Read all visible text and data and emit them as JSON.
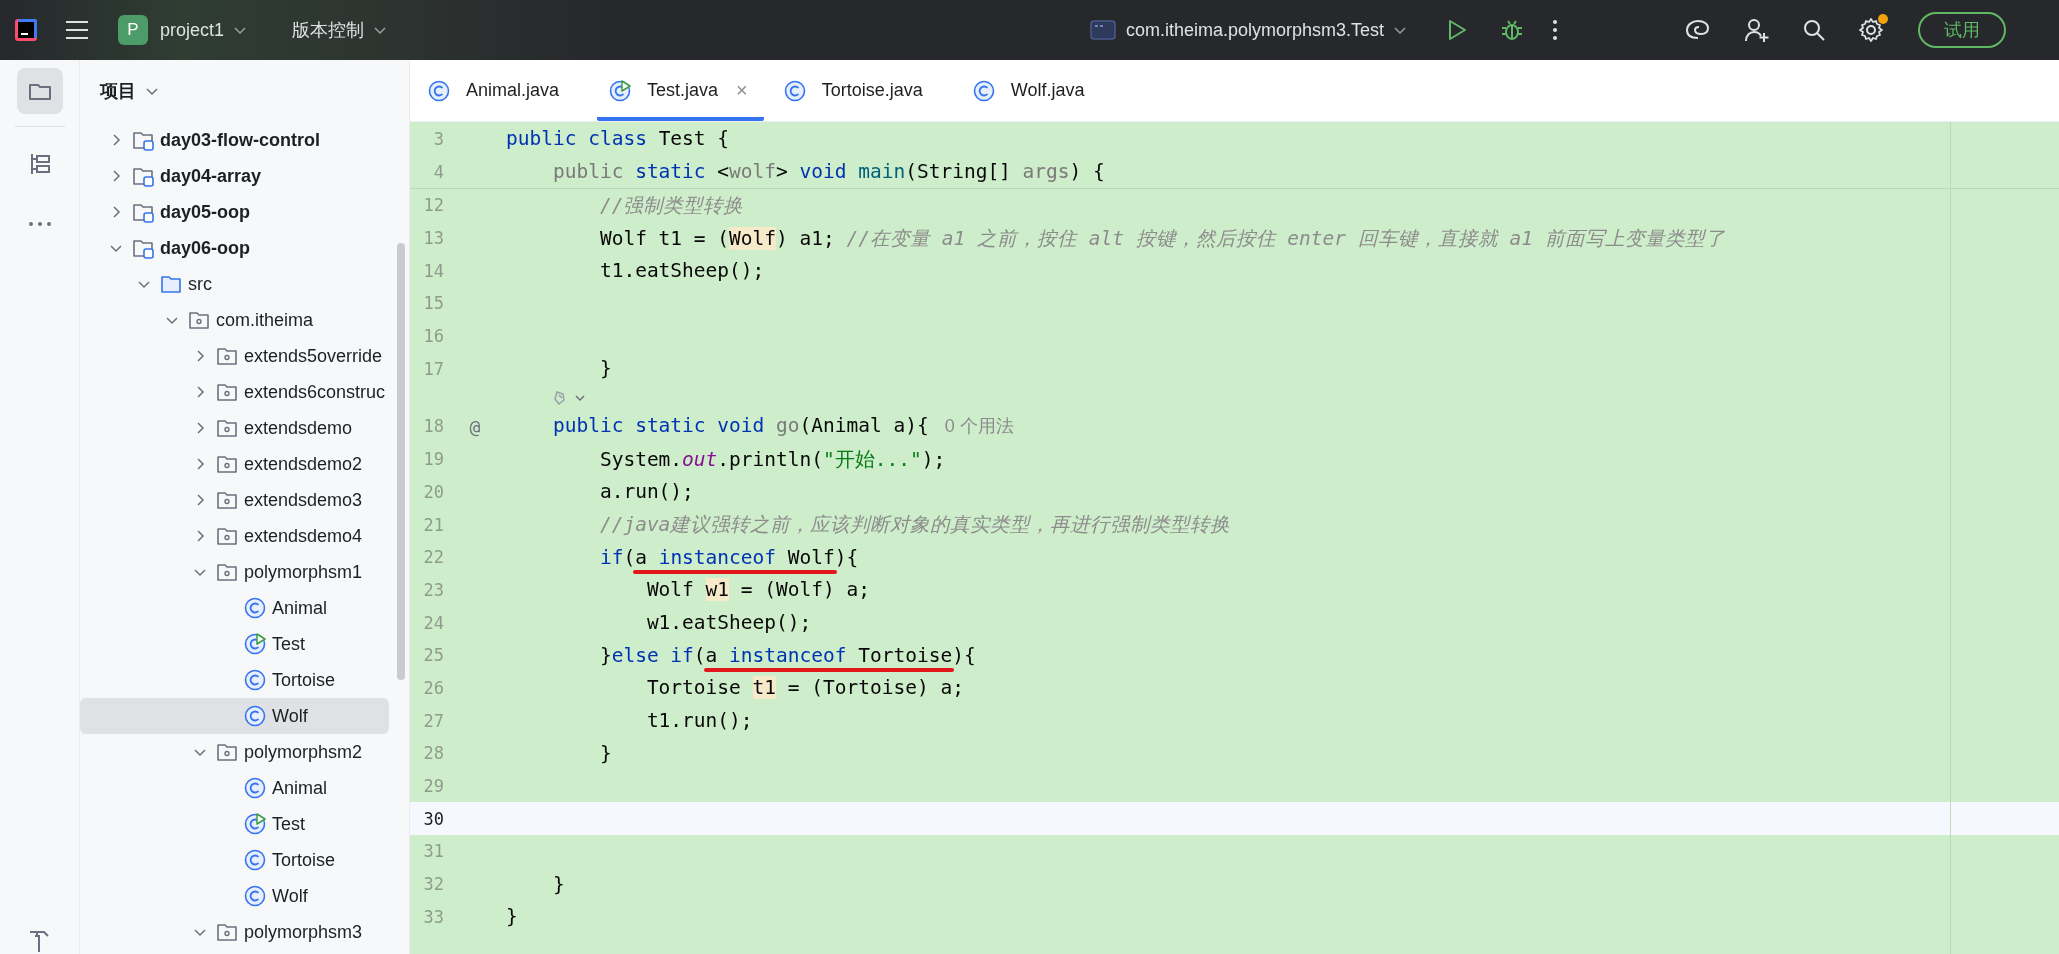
{
  "toolbar": {
    "project_badge": "P",
    "project_name": "project1",
    "vcs_menu": "版本控制",
    "run_configuration": "com.itheima.polymorphsm3.Test",
    "settings_notification": true,
    "trial_button": "试用"
  },
  "tool_strip": [
    {
      "kind": "project",
      "selected": true
    },
    {
      "kind": "structure",
      "selected": false
    },
    {
      "kind": "more",
      "selected": false
    },
    {
      "kind": "build",
      "selected": false
    }
  ],
  "project_panel": {
    "title": "项目",
    "tree": [
      {
        "label": "day03-flow-control",
        "kind": "module",
        "expanded": false,
        "selected": false
      },
      {
        "label": "day04-array",
        "kind": "module",
        "expanded": false,
        "selected": false
      },
      {
        "label": "day05-oop",
        "kind": "module",
        "expanded": false,
        "selected": false
      },
      {
        "label": "day06-oop",
        "kind": "module",
        "expanded": true,
        "selected": false,
        "children": [
          {
            "label": "src",
            "kind": "source",
            "expanded": true,
            "selected": false,
            "children": [
              {
                "label": "com.itheima",
                "kind": "package",
                "expanded": true,
                "selected": false,
                "children": [
                  {
                    "label": "extends5override",
                    "kind": "package",
                    "expanded": false,
                    "selected": false
                  },
                  {
                    "label": "extends6construc",
                    "kind": "package",
                    "expanded": false,
                    "selected": false
                  },
                  {
                    "label": "extendsdemo",
                    "kind": "package",
                    "expanded": false,
                    "selected": false
                  },
                  {
                    "label": "extendsdemo2",
                    "kind": "package",
                    "expanded": false,
                    "selected": false
                  },
                  {
                    "label": "extendsdemo3",
                    "kind": "package",
                    "expanded": false,
                    "selected": false
                  },
                  {
                    "label": "extendsdemo4",
                    "kind": "package",
                    "expanded": false,
                    "selected": false
                  },
                  {
                    "label": "polymorphsm1",
                    "kind": "package",
                    "expanded": true,
                    "selected": false,
                    "children": [
                      {
                        "label": "Animal",
                        "kind": "class",
                        "selected": false
                      },
                      {
                        "label": "Test",
                        "kind": "runnable-class",
                        "selected": false
                      },
                      {
                        "label": "Tortoise",
                        "kind": "class",
                        "selected": false
                      },
                      {
                        "label": "Wolf",
                        "kind": "class",
                        "selected": true
                      }
                    ]
                  },
                  {
                    "label": "polymorphsm2",
                    "kind": "package",
                    "expanded": true,
                    "selected": false,
                    "children": [
                      {
                        "label": "Animal",
                        "kind": "class",
                        "selected": false
                      },
                      {
                        "label": "Test",
                        "kind": "runnable-class",
                        "selected": false
                      },
                      {
                        "label": "Tortoise",
                        "kind": "class",
                        "selected": false
                      },
                      {
                        "label": "Wolf",
                        "kind": "class",
                        "selected": false
                      }
                    ]
                  },
                  {
                    "label": "polymorphsm3",
                    "kind": "package",
                    "expanded": true,
                    "selected": false
                  }
                ]
              }
            ]
          }
        ]
      }
    ]
  },
  "tabs": [
    {
      "label": "Animal.java",
      "kind": "class",
      "selected": false
    },
    {
      "label": "Test.java",
      "kind": "runnable-class",
      "selected": true,
      "close": "×"
    },
    {
      "label": "Tortoise.java",
      "kind": "class",
      "selected": false
    },
    {
      "label": "Wolf.java",
      "kind": "class",
      "selected": false
    }
  ],
  "editor": {
    "sticky_lines": [
      {
        "kind": "code",
        "number": "3",
        "current": false,
        "tokens": [
          {
            "kind": "keyword",
            "text": "public class"
          },
          {
            "kind": "plain",
            "text": " Test {"
          }
        ]
      },
      {
        "kind": "code",
        "number": "4",
        "current": false,
        "tokens": [
          {
            "kind": "unused",
            "text": "    public "
          },
          {
            "kind": "keyword",
            "text": "static"
          },
          {
            "kind": "plain",
            "text": " <"
          },
          {
            "kind": "unused",
            "text": "wolf"
          },
          {
            "kind": "plain",
            "text": "> "
          },
          {
            "kind": "keyword",
            "text": "void "
          },
          {
            "kind": "method",
            "text": "main"
          },
          {
            "kind": "plain",
            "text": "(String[] "
          },
          {
            "kind": "unused",
            "text": "args"
          },
          {
            "kind": "plain",
            "text": ") {"
          }
        ]
      }
    ],
    "lines": [
      {
        "kind": "code",
        "number": "12",
        "current": false,
        "tokens": [
          {
            "kind": "comment",
            "text": "        //强制类型转换"
          }
        ]
      },
      {
        "kind": "code",
        "number": "13",
        "current": false,
        "tokens": [
          {
            "kind": "plain",
            "text": "        Wolf t1 = ("
          },
          {
            "kind": "highlight",
            "text": "Wolf"
          },
          {
            "kind": "plain",
            "text": ") a1; "
          },
          {
            "kind": "comment",
            "text": "//在变量 a1 之前，按住 alt 按键，然后按住 enter 回车键，直接就 a1 前面写上变量类型了"
          }
        ]
      },
      {
        "kind": "code",
        "number": "14",
        "current": false,
        "tokens": [
          {
            "kind": "plain",
            "text": "        t1.eatSheep();"
          }
        ]
      },
      {
        "kind": "code",
        "number": "15",
        "current": false
      },
      {
        "kind": "code",
        "number": "16",
        "current": false
      },
      {
        "kind": "code",
        "number": "17",
        "current": false,
        "tokens": [
          {
            "kind": "plain",
            "text": "        }"
          }
        ]
      },
      {
        "kind": "inlay"
      },
      {
        "kind": "code",
        "number": "18",
        "current": false,
        "gutter_mark": "@",
        "tokens": [
          {
            "kind": "keyword",
            "text": "    public static void "
          },
          {
            "kind": "unused",
            "text": "go"
          },
          {
            "kind": "plain",
            "text": "(Animal a){"
          },
          {
            "kind": "hint",
            "text": "0 个用法"
          }
        ]
      },
      {
        "kind": "code",
        "number": "19",
        "current": false,
        "tokens": [
          {
            "kind": "plain",
            "text": "        System."
          },
          {
            "kind": "field",
            "text": "out"
          },
          {
            "kind": "plain",
            "text": ".println("
          },
          {
            "kind": "string",
            "text": "\"开始...\""
          },
          {
            "kind": "plain",
            "text": ");"
          }
        ]
      },
      {
        "kind": "code",
        "number": "20",
        "current": false,
        "tokens": [
          {
            "kind": "plain",
            "text": "        a.run();"
          }
        ]
      },
      {
        "kind": "code",
        "number": "21",
        "current": false,
        "tokens": [
          {
            "kind": "comment",
            "text": "        //java建议强转之前，应该判断对象的真实类型，再进行强制类型转换"
          }
        ]
      },
      {
        "kind": "code",
        "number": "22",
        "current": false,
        "tokens": [
          {
            "kind": "keyword",
            "text": "        if"
          },
          {
            "kind": "plain",
            "text": "("
          },
          {
            "kind": "underlined",
            "tokens": [
              {
                "kind": "plain",
                "text": "a "
              },
              {
                "kind": "keyword",
                "text": "instanceof"
              },
              {
                "kind": "plain",
                "text": " Wolf"
              }
            ]
          },
          {
            "kind": "plain",
            "text": "){"
          }
        ]
      },
      {
        "kind": "code",
        "number": "23",
        "current": false,
        "tokens": [
          {
            "kind": "plain",
            "text": "            Wolf "
          },
          {
            "kind": "highlight",
            "text": "w1"
          },
          {
            "kind": "plain",
            "text": " = (Wolf) a;"
          }
        ]
      },
      {
        "kind": "code",
        "number": "24",
        "current": false,
        "tokens": [
          {
            "kind": "plain",
            "text": "            w1.eatSheep();"
          }
        ]
      },
      {
        "kind": "code",
        "number": "25",
        "current": false,
        "tokens": [
          {
            "kind": "plain",
            "text": "        }"
          },
          {
            "kind": "keyword",
            "text": "else if"
          },
          {
            "kind": "plain",
            "text": "("
          },
          {
            "kind": "underlined",
            "tokens": [
              {
                "kind": "plain",
                "text": "a "
              },
              {
                "kind": "keyword",
                "text": "instanceof"
              },
              {
                "kind": "plain",
                "text": " Tortoise"
              }
            ]
          },
          {
            "kind": "plain",
            "text": "){"
          }
        ]
      },
      {
        "kind": "code",
        "number": "26",
        "current": false,
        "tokens": [
          {
            "kind": "plain",
            "text": "            Tortoise "
          },
          {
            "kind": "highlight",
            "text": "t1"
          },
          {
            "kind": "plain",
            "text": " = (Tortoise) a;"
          }
        ]
      },
      {
        "kind": "code",
        "number": "27",
        "current": false,
        "tokens": [
          {
            "kind": "plain",
            "text": "            t1.run();"
          }
        ]
      },
      {
        "kind": "code",
        "number": "28",
        "current": false,
        "tokens": [
          {
            "kind": "plain",
            "text": "        }"
          }
        ]
      },
      {
        "kind": "code",
        "number": "29",
        "current": false
      },
      {
        "kind": "code",
        "number": "30",
        "current": true
      },
      {
        "kind": "code",
        "number": "31",
        "current": false
      },
      {
        "kind": "code",
        "number": "32",
        "current": false,
        "tokens": [
          {
            "kind": "plain",
            "text": "    }"
          }
        ]
      },
      {
        "kind": "code",
        "number": "33",
        "current": false,
        "tokens": [
          {
            "kind": "plain",
            "text": "}"
          }
        ]
      }
    ]
  }
}
